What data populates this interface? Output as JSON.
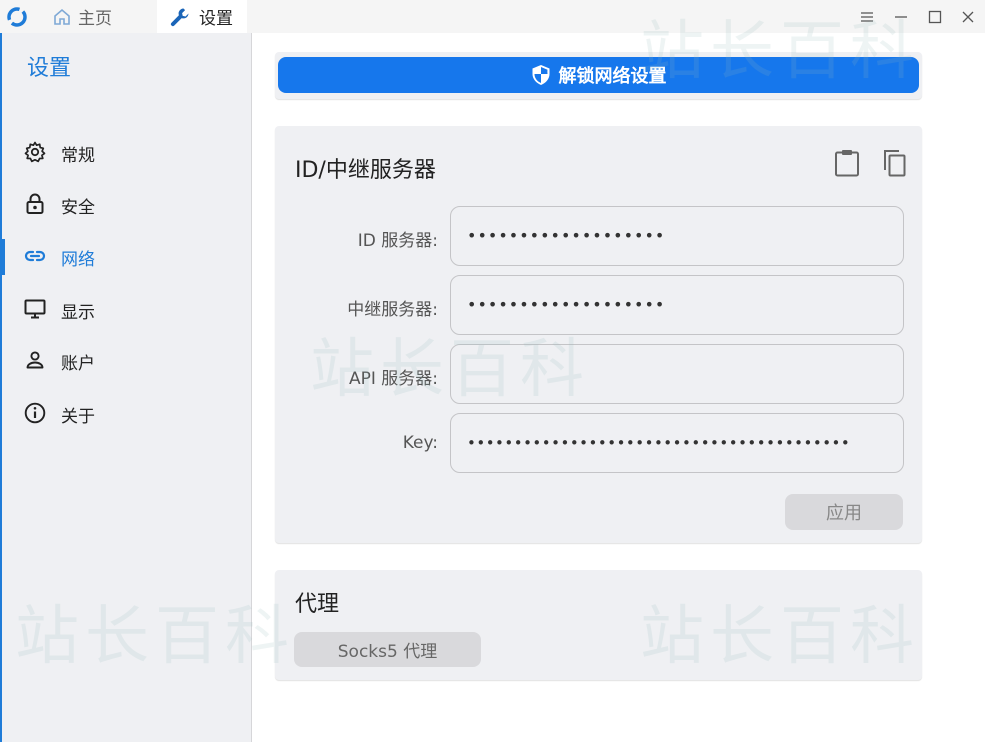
{
  "titlebar": {
    "tabs": [
      {
        "label": "主页",
        "icon": "home-icon"
      },
      {
        "label": "设置",
        "icon": "wrench-icon"
      }
    ],
    "controls": [
      "menu-icon",
      "minimize-icon",
      "maximize-icon",
      "close-icon"
    ]
  },
  "sidebar": {
    "title": "设置",
    "items": [
      {
        "label": "常规",
        "icon": "gear-icon"
      },
      {
        "label": "安全",
        "icon": "lock-icon"
      },
      {
        "label": "网络",
        "icon": "link-icon",
        "active": true
      },
      {
        "label": "显示",
        "icon": "monitor-icon"
      },
      {
        "label": "账户",
        "icon": "person-icon"
      },
      {
        "label": "关于",
        "icon": "info-icon"
      }
    ]
  },
  "main": {
    "unlock_button": "解锁网络设置",
    "id_relay": {
      "title": "ID/中继服务器",
      "fields": [
        {
          "label": "ID 服务器:",
          "value": "•••••••••••••••••••"
        },
        {
          "label": "中继服务器:",
          "value": "•••••••••••••••••••"
        },
        {
          "label": "API 服务器:",
          "value": ""
        },
        {
          "label": "Key:",
          "value": "•••••••••••••••••••••••••••••••••••••••••"
        }
      ],
      "apply_label": "应用"
    },
    "proxy": {
      "title": "代理",
      "socks_label": "Socks5 代理"
    }
  },
  "watermark": "站长百科",
  "colors": {
    "accent": "#1f7cd8",
    "unlock_button": "#1677ec",
    "card_bg": "#eff0f3",
    "disabled_button": "#d9d9dc"
  }
}
